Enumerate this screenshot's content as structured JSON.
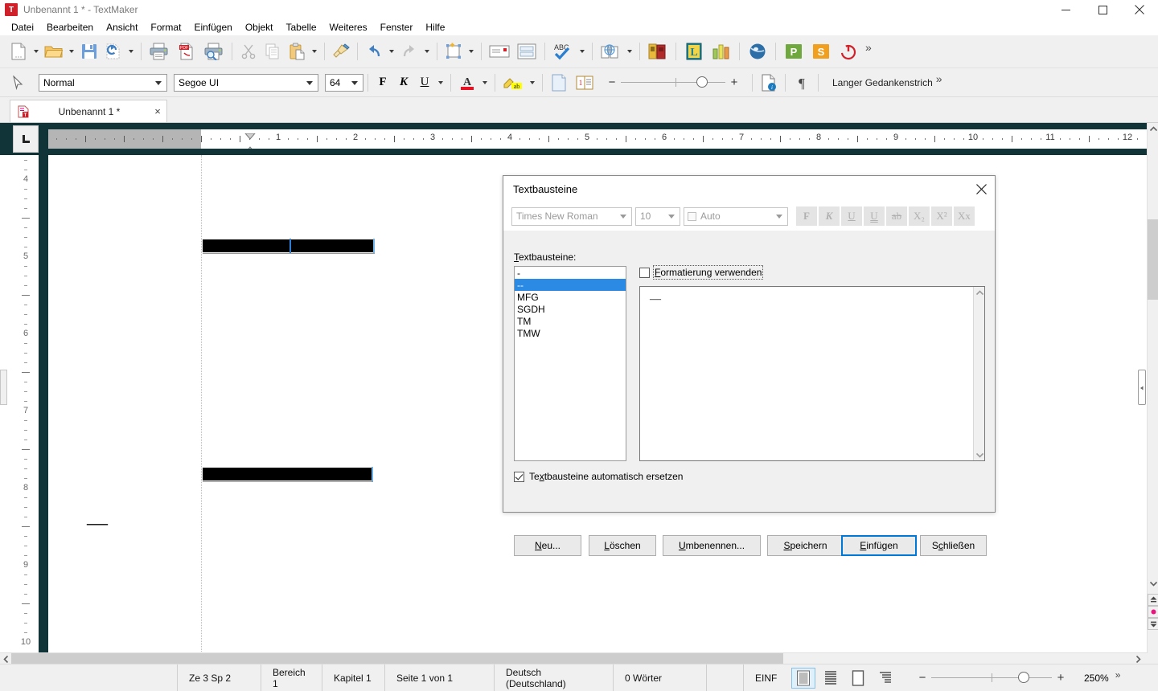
{
  "window": {
    "title": "Unbenannt 1 * - TextMaker",
    "app_icon": "T",
    "minimize": "minimize-icon",
    "maximize": "maximize-icon",
    "close": "close-icon"
  },
  "menu": {
    "items": [
      {
        "label": "Datei"
      },
      {
        "label": "Bearbeiten"
      },
      {
        "label": "Ansicht"
      },
      {
        "label": "Format"
      },
      {
        "label": "Einfügen"
      },
      {
        "label": "Objekt"
      },
      {
        "label": "Tabelle"
      },
      {
        "label": "Weiteres"
      },
      {
        "label": "Fenster"
      },
      {
        "label": "Hilfe"
      }
    ]
  },
  "toolbar": {
    "overflow": "»",
    "buttons": [
      {
        "name": "new-document-icon"
      },
      {
        "name": "open-document-icon"
      },
      {
        "name": "save-icon"
      },
      {
        "name": "restore-icon"
      },
      {
        "name": "print-icon"
      },
      {
        "name": "export-pdf-icon"
      },
      {
        "name": "print-preview-icon"
      },
      {
        "name": "cut-icon"
      },
      {
        "name": "copy-icon"
      },
      {
        "name": "paste-icon"
      },
      {
        "name": "format-painter-icon"
      },
      {
        "name": "undo-icon"
      },
      {
        "name": "redo-icon"
      },
      {
        "name": "insert-object-icon"
      },
      {
        "name": "envelope-icon"
      },
      {
        "name": "labels-icon"
      },
      {
        "name": "spellcheck-icon"
      },
      {
        "name": "thesaurus-icon"
      },
      {
        "name": "library-icon"
      },
      {
        "name": "presentations-icon"
      },
      {
        "name": "planmaker-icon"
      },
      {
        "name": "globe-icon"
      },
      {
        "name": "presentations-app-icon"
      },
      {
        "name": "softmaker-app-icon"
      },
      {
        "name": "exit-icon"
      }
    ]
  },
  "format_toolbar": {
    "paragraph_style": "Normal",
    "font_name": "Segoe UI",
    "font_size": "64",
    "bold": "F",
    "italic": "K",
    "underline": "U",
    "font_color": "A",
    "highlight": "ab",
    "hint_text": "Langer Gedankenstrich",
    "overflow": "»"
  },
  "tabs": [
    {
      "label": "Unbenannt 1 *",
      "close": "×",
      "active": true
    }
  ],
  "ruler": {
    "horizontal_numbers": [
      "1",
      "2",
      "3",
      "4",
      "5",
      "6",
      "7",
      "8",
      "9",
      "10",
      "11",
      "12"
    ],
    "vertical_numbers": [
      "4",
      "5",
      "6",
      "7",
      "8",
      "9",
      "10"
    ],
    "tab_selector": "L"
  },
  "document": {
    "emdash": "—"
  },
  "dialog": {
    "title": "Textbausteine",
    "close": "×",
    "format_bar": {
      "font_name": "Times New Roman",
      "font_size": "10",
      "color": "Auto",
      "bold": "F",
      "italic": "K",
      "underline": "U",
      "double_underline": "U",
      "strikethrough": "ab",
      "subscript": "X₂",
      "superscript": "X²",
      "allcaps": "Xx"
    },
    "list_label": "Textbausteine:",
    "list_items": [
      {
        "label": "-",
        "selected": false
      },
      {
        "label": "--",
        "selected": true
      },
      {
        "label": "MFG",
        "selected": false
      },
      {
        "label": "SGDH",
        "selected": false
      },
      {
        "label": "TM",
        "selected": false
      },
      {
        "label": "TMW",
        "selected": false
      }
    ],
    "use_formatting": {
      "label": "Formatierung verwenden",
      "checked": false
    },
    "preview_text": "—",
    "auto_replace": {
      "label": "Textbausteine automatisch ersetzen",
      "checked": true
    },
    "buttons": [
      {
        "label": "Neu...",
        "default": false
      },
      {
        "label": "Löschen",
        "default": false
      },
      {
        "label": "Umbenennen...",
        "default": false
      },
      {
        "label": "Speichern",
        "default": false
      },
      {
        "label": "Einfügen",
        "default": true
      },
      {
        "label": "Schließen",
        "default": false
      }
    ]
  },
  "statusbar": {
    "cursor": "Ze 3 Sp 2",
    "section": "Bereich 1",
    "chapter": "Kapitel 1",
    "page": "Seite 1 von 1",
    "language": "Deutsch (Deutschland)",
    "words": "0 Wörter",
    "insert_mode": "EINF",
    "zoom": "250%",
    "zoom_minus": "−",
    "zoom_plus": "+",
    "overflow": "»",
    "view_buttons": [
      {
        "name": "view-normal-icon",
        "active": true
      },
      {
        "name": "view-continuous-icon",
        "active": false
      },
      {
        "name": "view-page-icon",
        "active": false
      },
      {
        "name": "view-outline-icon",
        "active": false
      }
    ]
  },
  "colors": {
    "accent": "#2a8ae4",
    "ruler_bg": "#103437",
    "selection": "#2a8ae4",
    "default_button_border": "#0078d7",
    "titlebar_text": "#7a7a7a"
  }
}
